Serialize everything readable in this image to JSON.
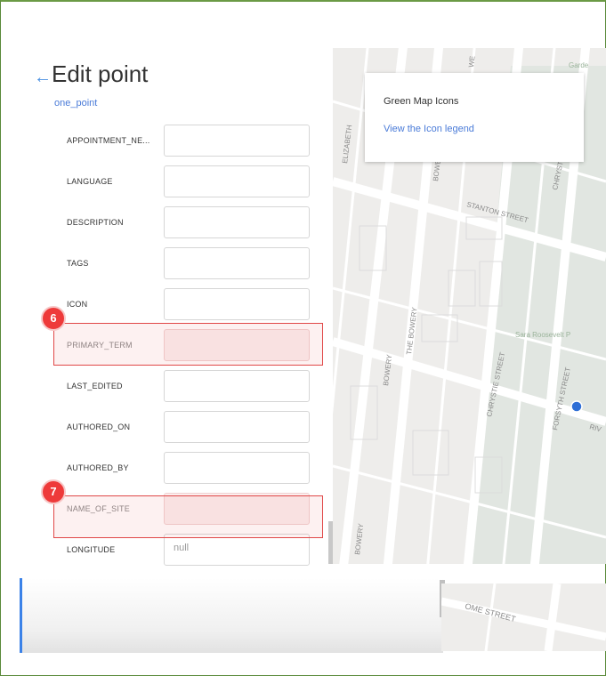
{
  "header": {
    "title": "Edit point",
    "subtitle": "one_point"
  },
  "fields": [
    {
      "label": "APPOINTMENT_NE...",
      "value": ""
    },
    {
      "label": "LANGUAGE",
      "value": ""
    },
    {
      "label": "DESCRIPTION",
      "value": ""
    },
    {
      "label": "TAGS",
      "value": ""
    },
    {
      "label": "ICON",
      "value": ""
    },
    {
      "label": "PRIMARY_TERM",
      "value": ""
    },
    {
      "label": "LAST_EDITED",
      "value": ""
    },
    {
      "label": "AUTHORED_ON",
      "value": ""
    },
    {
      "label": "AUTHORED_BY",
      "value": ""
    },
    {
      "label": "NAME_OF_SITE",
      "value": ""
    },
    {
      "label": "LONGITUDE",
      "value": "null"
    }
  ],
  "markers": {
    "m6": "6",
    "m7": "7"
  },
  "legend": {
    "title": "Green Map Icons",
    "link": "View the Icon legend"
  },
  "map": {
    "streets": [
      "ELIZABETH",
      "BOWERY",
      "STANTON STREET",
      "CHRYSTIE STREET",
      "THE BOWERY",
      "BOWERY",
      "CHRYSTIE STREET",
      "FORSYTH STREET",
      "RIV",
      "BOWERY",
      "WE",
      "Sara Roosevelt P",
      "Garde",
      "OME STREET"
    ]
  },
  "colors": {
    "accent": "#3b82e8",
    "highlight": "#e04848",
    "link": "#4a7bd8"
  }
}
